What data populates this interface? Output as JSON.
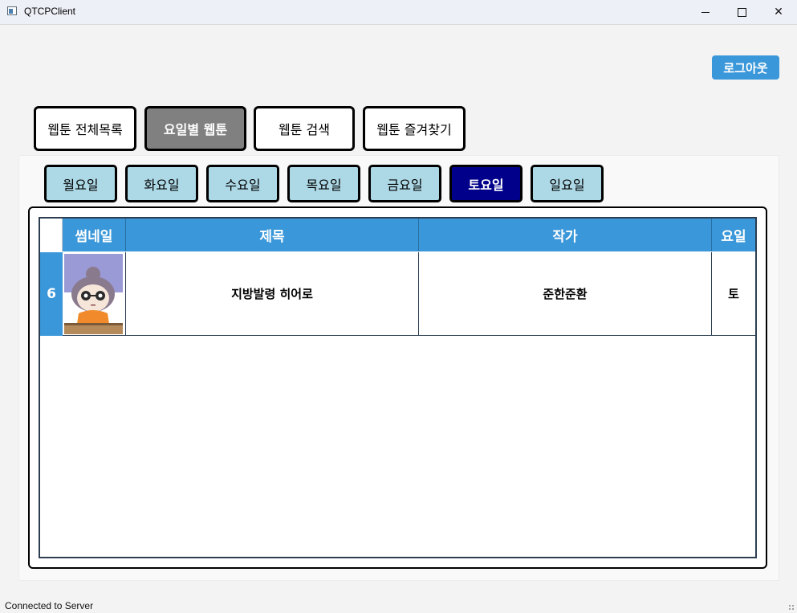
{
  "window": {
    "title": "QTCPClient"
  },
  "header": {
    "logout_label": "로그아웃"
  },
  "main_tabs": [
    {
      "label": "웹툰 전체목록",
      "active": false
    },
    {
      "label": "요일별 웹툰",
      "active": true
    },
    {
      "label": "웹툰 검색",
      "active": false
    },
    {
      "label": "웹툰 즐겨찾기",
      "active": false
    }
  ],
  "days": [
    {
      "label": "월요일",
      "active": false
    },
    {
      "label": "화요일",
      "active": false
    },
    {
      "label": "수요일",
      "active": false
    },
    {
      "label": "목요일",
      "active": false
    },
    {
      "label": "금요일",
      "active": false
    },
    {
      "label": "토요일",
      "active": true
    },
    {
      "label": "일요일",
      "active": false
    }
  ],
  "table": {
    "columns": [
      "썸네일",
      "제목",
      "작가",
      "요일"
    ],
    "rows": [
      {
        "row_header": "6",
        "thumbnail": "webtoon-thumbnail-image",
        "title": "지방발령 히어로",
        "author": "준한준환",
        "day": "토"
      }
    ]
  },
  "status": {
    "text": "Connected to Server"
  },
  "colors": {
    "accent": "#3a97d9",
    "active_day": "#00008b",
    "day_button": "#add8e6",
    "active_tab": "#808080"
  }
}
